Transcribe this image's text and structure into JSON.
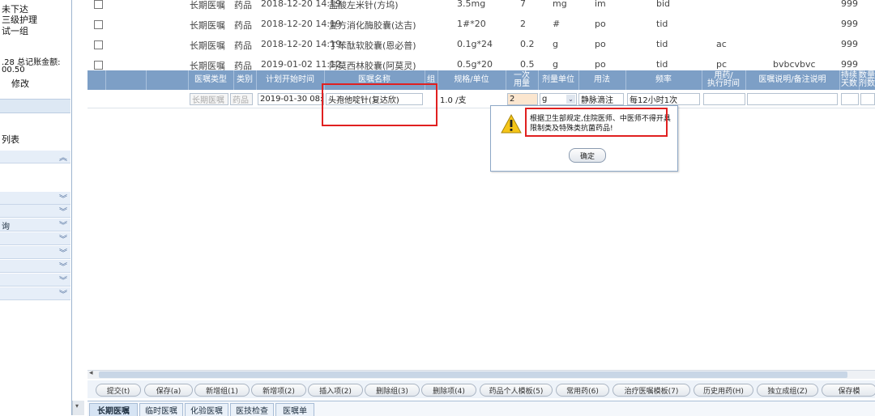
{
  "left_panel": {
    "lines": [
      "未下达",
      "三级护理",
      "试一组"
    ],
    "amount_text": ".28 总记账金额:",
    "amount_value": "00.50",
    "edit_label": "修改",
    "list_label": "列表",
    "query_label": "询"
  },
  "orders": [
    {
      "type": "长期医嘱",
      "category": "药品",
      "time": "2018-12-20 14:19",
      "name": "盐酸左米针(方坞)",
      "spec": "3.5mg",
      "dose": "7",
      "unit": "mg",
      "route": "im",
      "freq": "bid",
      "note": "",
      "remark": "",
      "qty": "999"
    },
    {
      "type": "长期医嘱",
      "category": "药品",
      "time": "2018-12-20 14:19",
      "name": "复方消化酶胶囊(达吉)",
      "spec": "1#*20",
      "dose": "2",
      "unit": "#",
      "route": "po",
      "freq": "tid",
      "note": "",
      "remark": "",
      "qty": "999"
    },
    {
      "type": "长期医嘱",
      "category": "药品",
      "time": "2018-12-20 14:19",
      "name": "丁苯酞软胶囊(恩必普)",
      "spec": "0.1g*24",
      "dose": "0.2",
      "unit": "g",
      "route": "po",
      "freq": "tid",
      "note": "ac",
      "remark": "",
      "qty": "999"
    },
    {
      "type": "长期医嘱",
      "category": "药品",
      "time": "2019-01-02 11:12",
      "name": "阿莫西林胶囊(阿莫灵)",
      "spec": "0.5g*20",
      "dose": "0.5",
      "unit": "g",
      "route": "po",
      "freq": "tid",
      "note": "pc",
      "remark": "bvbcvbvc",
      "qty": "999"
    }
  ],
  "columns": {
    "type": "医嘱类型",
    "category": "类别",
    "start_time": "计划开始时间",
    "name": "医嘱名称",
    "group": "组",
    "spec": "规格/单位",
    "dose_line1": "一次",
    "dose_line2": "用量",
    "dose_unit": "剂量单位",
    "route": "用法",
    "freq": "频率",
    "exec_line1": "用药/",
    "exec_line2": "执行时间",
    "remark": "医嘱说明/备注说明",
    "days_line1": "持续",
    "days_line2": "天数",
    "qty_line1": "数量",
    "qty_line2": "剂数"
  },
  "edit_row": {
    "type": "长期医嘱",
    "category": "药品",
    "start_time": "2019-01-30 08:37",
    "name": "头孢他啶针(复达欣)",
    "spec": "1.0 /支",
    "dose": "2",
    "unit": "g",
    "route": "静脉滴注",
    "freq": "每12小时1次"
  },
  "dialog": {
    "message": "根据卫生部规定,住院医师、中医师不得开具限制类及特殊类抗菌药品!",
    "ok_label": "确定",
    "icon": "warning-icon"
  },
  "toolbar": [
    "提交(t)",
    "保存(a)",
    "新增组(1)",
    "新增项(2)",
    "插入项(2)",
    "删除组(3)",
    "删除项(4)",
    "药品个人模板(5)",
    "常用药(6)",
    "治疗医嘱模板(7)",
    "历史用药(H)",
    "独立成组(Z)",
    "保存模"
  ],
  "tabs": [
    "长期医嘱",
    "临时医嘱",
    "化验医嘱",
    "医技检查",
    "医嘱单"
  ],
  "colors": {
    "header_bg": "#7d9fc6",
    "highlight": "#e02020",
    "accent": "#4a6a99"
  }
}
